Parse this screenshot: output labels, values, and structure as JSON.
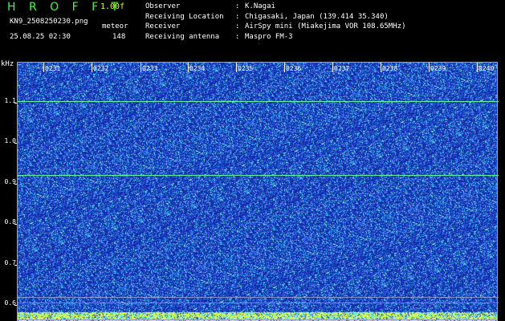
{
  "header": {
    "app_title": "H R O F F T",
    "version": "1.00f",
    "filename": "KN9_2508250230.png",
    "mode_label": "meteor",
    "datetime": "25.08.25 02:30",
    "count": "148"
  },
  "meta": [
    {
      "key": "Observer",
      "sep": ":",
      "value": "K.Nagai"
    },
    {
      "key": "Receiving Location",
      "sep": ":",
      "value": "Chigasaki, Japan (139.414 35.340)"
    },
    {
      "key": "Receiver",
      "sep": ":",
      "value": "AirSpy mini (Miakejima VOR 108.65MHz)"
    },
    {
      "key": "Receiving antenna",
      "sep": ":",
      "value": "Maspro FM-3"
    }
  ],
  "plot": {
    "y_unit": "kHz",
    "y_ticks": [
      "1.1",
      "1.0",
      "0.9",
      "0.8",
      "0.7",
      "0.6"
    ],
    "x_ticks": [
      "0231",
      "0232",
      "0233",
      "0234",
      "0235",
      "0236",
      "0237",
      "0238",
      "0239",
      "0240"
    ],
    "colors": {
      "background": "#1530a8",
      "noise_low": "#2a4bd8",
      "noise_high": "#4dd8ff",
      "line": "#63f2a0",
      "bottom_band": "#e6ff3a"
    }
  }
}
